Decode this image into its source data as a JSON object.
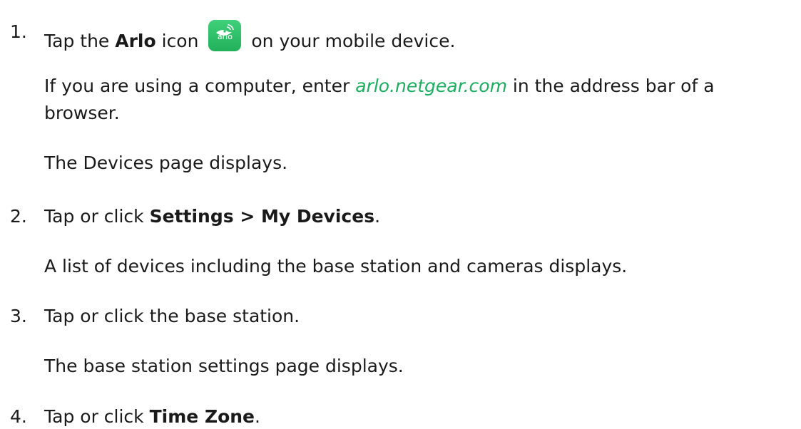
{
  "steps": [
    {
      "num": "1.",
      "lead": "Tap the ",
      "bold": "Arlo",
      "mid": " icon",
      "tail": "on your mobile device.",
      "icon_word": "arlo",
      "note_pre": "If you are using a computer, enter ",
      "note_link": "arlo.netgear.com",
      "note_post": " in the address bar of a browser.",
      "result": "The Devices page displays."
    },
    {
      "num": "2.",
      "lead": "Tap or click ",
      "bold": "Settings > My Devices",
      "tail": ".",
      "result": "A list of devices including the base station and cameras displays."
    },
    {
      "num": "3.",
      "lead": "Tap or click the base station.",
      "result": "The base station settings page displays."
    },
    {
      "num": "4.",
      "lead": "Tap or click ",
      "bold": "Time Zone",
      "tail": "."
    }
  ],
  "colors": {
    "link": "#1aae5e",
    "icon_bg": "#2cbf68"
  },
  "icons": {
    "app": "arlo-app-icon"
  }
}
